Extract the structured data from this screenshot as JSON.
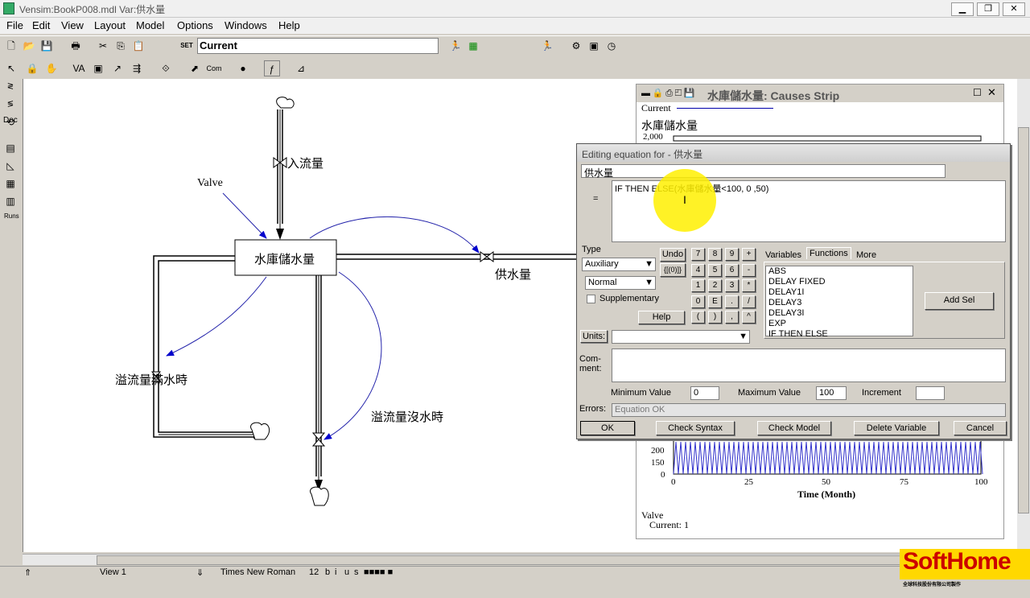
{
  "window": {
    "title": "Vensim:BookP008.mdl Var:供水量"
  },
  "menu": [
    "File",
    "Edit",
    "View",
    "Layout",
    "Model",
    "Options",
    "Windows",
    "Help"
  ],
  "toolbar": {
    "set_label": "SET",
    "run_name": "Current"
  },
  "left_tools": {
    "doc": "Doc",
    "runs": "Runs"
  },
  "model": {
    "stock": "水庫儲水量",
    "inflow": "入流量",
    "outflow": "供水量",
    "valve": "Valve",
    "overflow_full": "溢流量滿水時",
    "overflow_empty": "溢流量沒水時"
  },
  "strip": {
    "title": "水庫儲水量: Causes Strip",
    "run": "Current",
    "var": "水庫儲水量",
    "ymax": "2,000",
    "yticks": [
      "200",
      "150",
      "0"
    ],
    "xticks": [
      "0",
      "25",
      "50",
      "75",
      "100"
    ],
    "xlabel": "Time (Month)",
    "valve_label": "Valve",
    "valve_current": "Current: 1"
  },
  "dialog": {
    "title": "Editing equation for - 供水量",
    "var_name": "供水量",
    "equals": "=",
    "equation": "IF THEN ELSE(水庫儲水量<100, 0 ,50)",
    "type_label": "Type",
    "type_value": "Auxiliary",
    "subtype_value": "Normal",
    "supplementary": "Supplementary",
    "undo": "Undo",
    "brackets": "{[(0)]}",
    "help": "Help",
    "keypad": [
      "7",
      "8",
      "9",
      "+",
      "4",
      "5",
      "6",
      "-",
      "1",
      "2",
      "3",
      "*",
      "0",
      "E",
      ".",
      "/",
      "(",
      ")",
      ",",
      "^"
    ],
    "tabs": [
      "Variables",
      "Functions",
      "More"
    ],
    "functions": [
      "ABS",
      "DELAY FIXED",
      "DELAY1I",
      "DELAY3",
      "DELAY3I",
      "EXP",
      "IF THEN ELSE"
    ],
    "add_sel": "Add Sel",
    "units_label": "Units:",
    "comment_label": "Com-\nment:",
    "min_label": "Minimum Value",
    "min_value": "0",
    "max_label": "Maximum Value",
    "max_value": "100",
    "inc_label": "Increment",
    "inc_value": "",
    "errors_label": "Errors:",
    "errors_value": "Equation OK",
    "ok": "OK",
    "check_syntax": "Check Syntax",
    "check_model": "Check Model",
    "delete_variable": "Delete Variable",
    "cancel": "Cancel"
  },
  "status": {
    "view": "View 1",
    "font": "Times New Roman",
    "size": "12",
    "b": "b",
    "i": "i",
    "u": "u",
    "s": "s"
  },
  "logo": {
    "text": "SoftHome",
    "sub": "全球科技股份有限公司製作"
  }
}
